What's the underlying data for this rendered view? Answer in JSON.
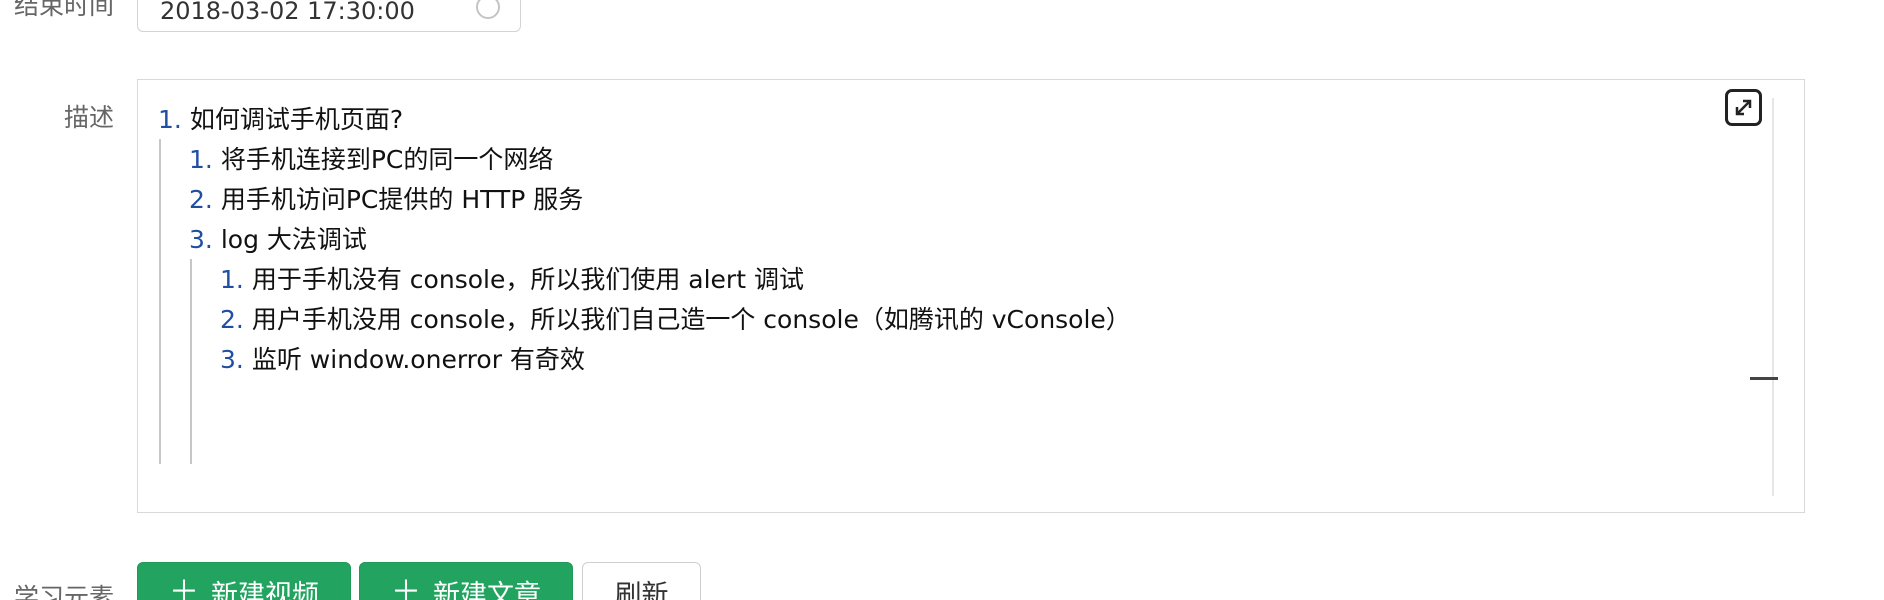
{
  "form": {
    "end_time": {
      "label": "结束时间",
      "value": "2018-03-02 17:30:00",
      "icon": "clock-icon"
    },
    "description": {
      "label": "描述",
      "fullscreen_icon": "expand-icon",
      "items": [
        {
          "num": "1.",
          "text": "如何调试手机页面?"
        },
        {
          "num": "1.",
          "text": "将手机连接到PC的同一个网络"
        },
        {
          "num": "2.",
          "text": "用手机访问PC提供的 HTTP 服务"
        },
        {
          "num": "3.",
          "text": "log 大法调试"
        },
        {
          "num": "1.",
          "text": "用于手机没有 console，所以我们使用 alert 调试"
        },
        {
          "num": "2.",
          "text": "用户手机没用 console，所以我们自己造一个 console（如腾讯的 vConsole）"
        },
        {
          "num": "3.",
          "text": "监听 window.onerror 有奇效"
        }
      ]
    },
    "learning_elements": {
      "label": "学习元素",
      "buttons": {
        "new_video": "新建视频",
        "new_article": "新建文章",
        "refresh": "刷新"
      }
    }
  },
  "colors": {
    "primary_green": "#22a460",
    "number_blue": "#1f4ea3"
  }
}
